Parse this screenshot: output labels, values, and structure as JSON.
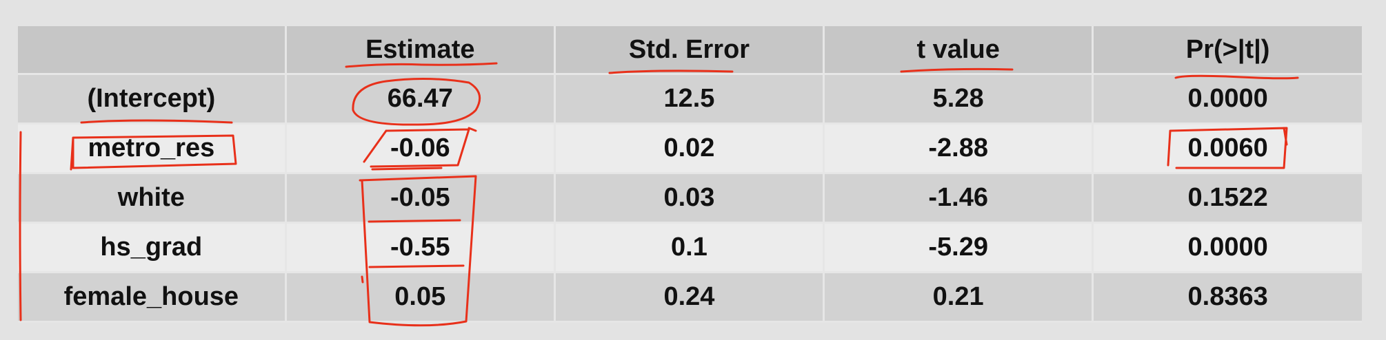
{
  "table": {
    "headers": [
      "",
      "Estimate",
      "Std. Error",
      "t value",
      "Pr(>|t|)"
    ],
    "rows": [
      [
        "(Intercept)",
        "66.47",
        "12.5",
        "5.28",
        "0.0000"
      ],
      [
        "metro_res",
        "-0.06",
        "0.02",
        "-2.88",
        "0.0060"
      ],
      [
        "white",
        "-0.05",
        "0.03",
        "-1.46",
        "0.1522"
      ],
      [
        "hs_grad",
        "-0.55",
        "0.1",
        "-5.29",
        "0.0000"
      ],
      [
        "female_house",
        "0.05",
        "0.24",
        "0.21",
        "0.8363"
      ]
    ]
  },
  "annotation_color": "#e8301a"
}
